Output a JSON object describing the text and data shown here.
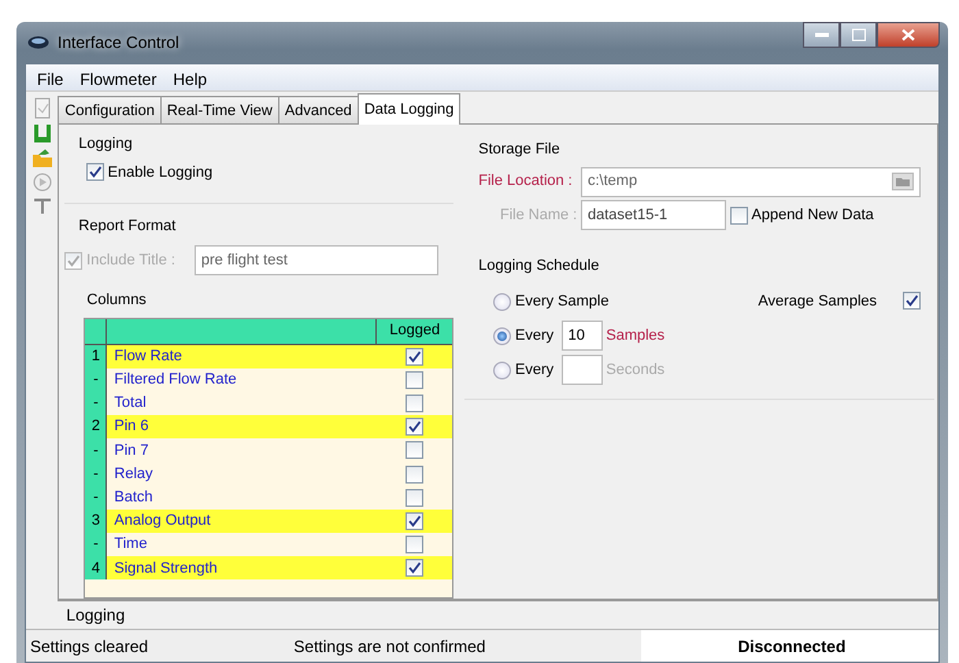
{
  "window": {
    "title": "Interface Control"
  },
  "menu": [
    "File",
    "Flowmeter",
    "Help"
  ],
  "tabs": [
    {
      "label": "Configuration",
      "selected": false
    },
    {
      "label": "Real-Time View",
      "selected": false
    },
    {
      "label": "Advanced",
      "selected": false
    },
    {
      "label": "Data Logging",
      "selected": true
    }
  ],
  "logging": {
    "title": "Logging",
    "enable_logging": {
      "label": "Enable Logging",
      "checked": true
    }
  },
  "report_format": {
    "title": "Report Format",
    "include_title": {
      "label": "Include Title :",
      "checked": true,
      "disabled": true,
      "value": "pre flight test"
    }
  },
  "columns": {
    "title": "Columns",
    "header": "Logged",
    "rows": [
      {
        "index": "1",
        "name": "Flow Rate",
        "logged": true
      },
      {
        "index": "-",
        "name": "Filtered Flow Rate",
        "logged": false
      },
      {
        "index": "-",
        "name": "Total",
        "logged": false
      },
      {
        "index": "2",
        "name": "Pin 6",
        "logged": true
      },
      {
        "index": "-",
        "name": "Pin 7",
        "logged": false
      },
      {
        "index": "-",
        "name": "Relay",
        "logged": false
      },
      {
        "index": "-",
        "name": "Batch",
        "logged": false
      },
      {
        "index": "3",
        "name": "Analog Output",
        "logged": true
      },
      {
        "index": "-",
        "name": "Time",
        "logged": false
      },
      {
        "index": "4",
        "name": "Signal Strength",
        "logged": true
      }
    ]
  },
  "storage_file": {
    "title": "Storage File",
    "file_location": {
      "label": "File Location :",
      "value": "c:\\temp"
    },
    "file_name": {
      "label": "File Name :",
      "value": "dataset15-1",
      "disabled": true
    },
    "append_new_data": {
      "label": "Append New Data",
      "checked": false
    }
  },
  "logging_schedule": {
    "title": "Logging Schedule",
    "average_samples": {
      "label": "Average Samples",
      "checked": true
    },
    "options": [
      {
        "kind": "plain",
        "label": "Every Sample",
        "selected": false
      },
      {
        "kind": "count",
        "label": "Every",
        "value": "10",
        "unit": "Samples",
        "selected": true
      },
      {
        "kind": "count",
        "label": "Every",
        "unit": "Seconds",
        "selected": false
      }
    ]
  },
  "bottom_tab": "Logging",
  "status_bar": [
    "Settings cleared",
    "Settings are not confirmed",
    "Disconnected"
  ]
}
